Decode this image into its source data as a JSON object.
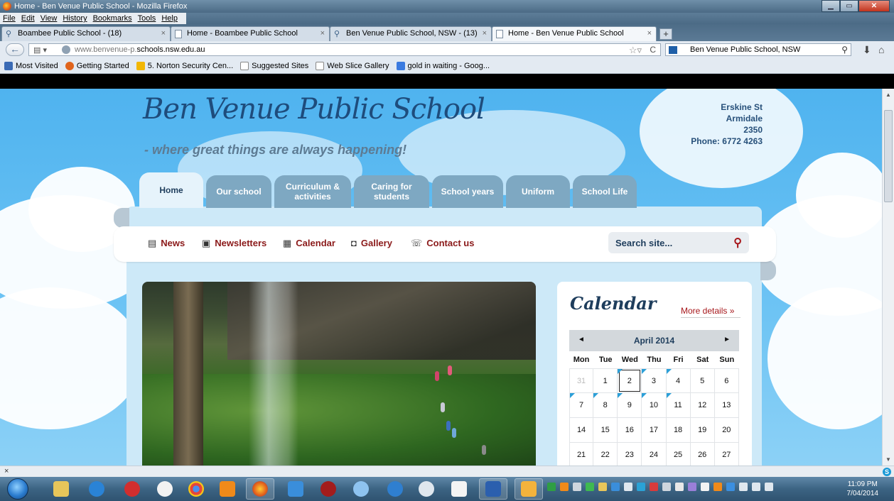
{
  "window": {
    "title": "Home - Ben Venue Public School - Mozilla Firefox",
    "min": "▁",
    "max": "▭",
    "close": "✕"
  },
  "menu": [
    "File",
    "Edit",
    "View",
    "History",
    "Bookmarks",
    "Tools",
    "Help"
  ],
  "tabs": [
    {
      "label": "Boambee Public School - (18)",
      "close": "×"
    },
    {
      "label": "Home - Boambee Public School",
      "close": "×"
    },
    {
      "label": "Ben Venue Public School, NSW - (13)",
      "close": "×"
    },
    {
      "label": "Home - Ben Venue Public School",
      "close": "×"
    }
  ],
  "newtab": "+",
  "navbar": {
    "url_prefix": "www.benvenue-p.",
    "url_host": "schools.nsw.edu.au",
    "search_value": "Ben Venue Public School, NSW"
  },
  "bookmarks": [
    {
      "label": "Most Visited",
      "color": "#3b6bb5"
    },
    {
      "label": "Getting Started",
      "color": "#e0641d"
    },
    {
      "label": "5. Norton Security Cen...",
      "color": "#f2b705"
    },
    {
      "label": "Suggested Sites",
      "color": "#ffffff"
    },
    {
      "label": "Web Slice Gallery",
      "color": "#ffffff"
    },
    {
      "label": "gold in waiting - Goog...",
      "color": "#3b7be0"
    }
  ],
  "site": {
    "title": "Ben Venue Public School",
    "tagline": "- where great things are always happening!",
    "address": [
      "Erskine St",
      "Armidale",
      "2350",
      "Phone: 6772 4263"
    ]
  },
  "nav": [
    {
      "label": "Home"
    },
    {
      "label": "Our school"
    },
    {
      "label": "Curriculum & activities"
    },
    {
      "label": "Caring for students"
    },
    {
      "label": "School years"
    },
    {
      "label": "Uniform"
    },
    {
      "label": "School Life"
    }
  ],
  "quicklinks": [
    {
      "label": "News"
    },
    {
      "label": "Newsletters"
    },
    {
      "label": "Calendar"
    },
    {
      "label": "Gallery"
    },
    {
      "label": "Contact us"
    }
  ],
  "search": {
    "placeholder": "Search site..."
  },
  "calendar": {
    "title": "Calendar",
    "more": "More details »",
    "month": "April 2014",
    "prev": "◄",
    "next": "►",
    "dow": [
      "Mon",
      "Tue",
      "Wed",
      "Thu",
      "Fri",
      "Sat",
      "Sun"
    ],
    "weeks": [
      [
        {
          "d": "31",
          "m": true
        },
        {
          "d": "1"
        },
        {
          "d": "2",
          "t": true,
          "e": true
        },
        {
          "d": "3",
          "e": true
        },
        {
          "d": "4",
          "e": true
        },
        {
          "d": "5"
        },
        {
          "d": "6"
        }
      ],
      [
        {
          "d": "7",
          "e": true
        },
        {
          "d": "8",
          "e": true
        },
        {
          "d": "9",
          "e": true
        },
        {
          "d": "10",
          "e": true
        },
        {
          "d": "11",
          "e": true
        },
        {
          "d": "12"
        },
        {
          "d": "13"
        }
      ],
      [
        {
          "d": "14"
        },
        {
          "d": "15"
        },
        {
          "d": "16"
        },
        {
          "d": "17"
        },
        {
          "d": "18"
        },
        {
          "d": "19"
        },
        {
          "d": "20"
        }
      ],
      [
        {
          "d": "21"
        },
        {
          "d": "22"
        },
        {
          "d": "23"
        },
        {
          "d": "24"
        },
        {
          "d": "25"
        },
        {
          "d": "26"
        },
        {
          "d": "27"
        }
      ]
    ]
  },
  "addonbar": {
    "close": "×",
    "s": "S"
  },
  "clock": {
    "time": "11:09 PM",
    "date": "7/04/2014"
  }
}
